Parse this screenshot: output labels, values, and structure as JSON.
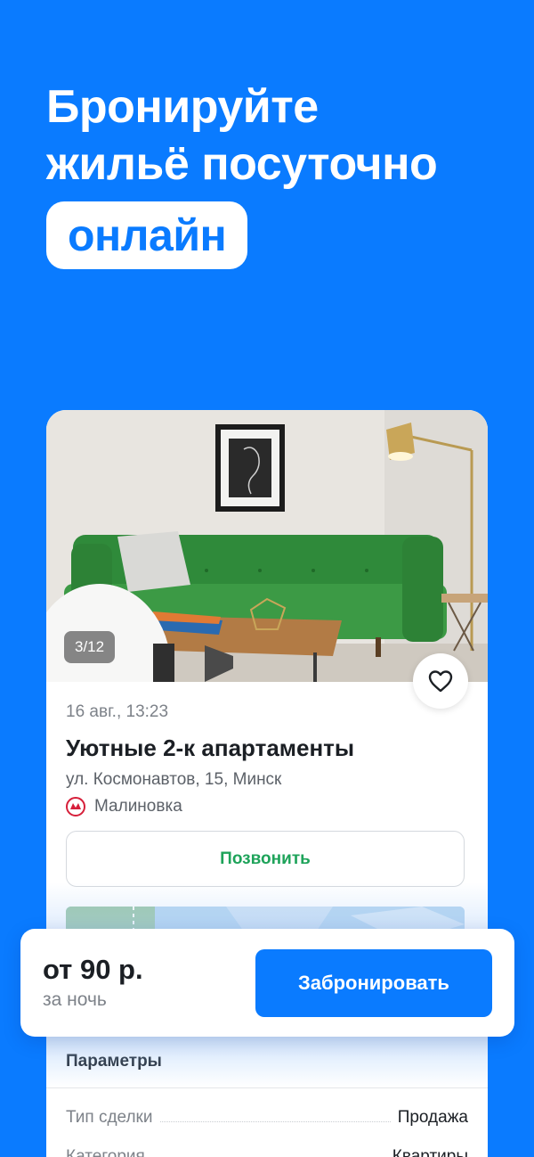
{
  "hero": {
    "line1": "Бронируйте",
    "line2": "жильё посуточно",
    "highlight": "онлайн"
  },
  "listing": {
    "photo_counter": "3/12",
    "date": "16 авг., 13:23",
    "title": "Уютные 2-к апартаменты",
    "address": "ул. Космонавтов, 15, Минск",
    "metro_icon": "metro-icon",
    "metro_station": "Малиновка",
    "call_label": "Позвонить",
    "favorite_icon": "heart-icon"
  },
  "booking": {
    "price": "от 90 р.",
    "period": "за ночь",
    "book_label": "Забронировать"
  },
  "params": {
    "title": "Параметры",
    "rows": [
      {
        "label": "Тип сделки",
        "value": "Продажа"
      },
      {
        "label": "Категория",
        "value": "Квартиры"
      }
    ]
  },
  "colors": {
    "brand_blue": "#0a7bff",
    "call_green": "#1ea35a",
    "metro_red": "#d61f3a"
  }
}
